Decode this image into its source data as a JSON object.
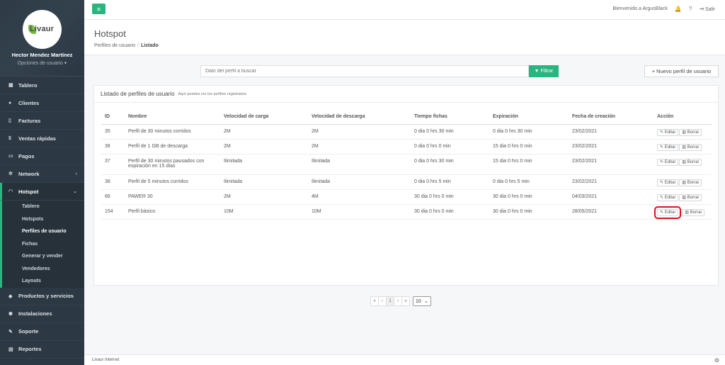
{
  "app": {
    "logo_text": "Livaur",
    "user_name": "Hector Mendez Martínez",
    "user_options": "Opciones de usuario ▾",
    "welcome": "Bienvenido a ArgusBlack",
    "logout": "Salir"
  },
  "sidebar": {
    "items": [
      {
        "label": "Tablero"
      },
      {
        "label": "Clientes"
      },
      {
        "label": "Facturas"
      },
      {
        "label": "Ventas rápidas"
      },
      {
        "label": "Pagos"
      },
      {
        "label": "Network"
      },
      {
        "label": "Hotspot"
      },
      {
        "label": "Productos y servicios"
      },
      {
        "label": "Instalaciones"
      },
      {
        "label": "Soporte"
      },
      {
        "label": "Reportes"
      }
    ],
    "hotspot_sub": [
      {
        "label": "Tablero"
      },
      {
        "label": "Hotspots"
      },
      {
        "label": "Perfiles de usuario"
      },
      {
        "label": "Fichas"
      },
      {
        "label": "Generar y vender"
      },
      {
        "label": "Vendedores"
      },
      {
        "label": "Layouts"
      }
    ]
  },
  "header": {
    "title": "Hotspot",
    "breadcrumb_parent": "Perfiles de usuario",
    "breadcrumb_current": "Listado"
  },
  "search": {
    "placeholder": "Dato del perfil a buscar",
    "filter_label": "Filtrar",
    "new_profile_label": "Nuevo perfil de usuario"
  },
  "panel": {
    "title": "Listado de perfiles de usuario",
    "subtitle": "Aquí puedes ver los perfiles registrados"
  },
  "table": {
    "headers": [
      "ID",
      "Nombre",
      "Velocidad de carga",
      "Velocidad de descarga",
      "Tiempo fichas",
      "Expiración",
      "Fecha de creación",
      "Acción"
    ],
    "rows": [
      [
        "35",
        "Perfil de 30 minutos corridos",
        "2M",
        "2M",
        "0 dia 0 hrs 30 min",
        "0 dia 0 hrs 30 min",
        "23/02/2021"
      ],
      [
        "36",
        "Perfil de 1 GB de descarga",
        "2M",
        "2M",
        "0 dia 0 hrs 0 min",
        "15 dia 0 hrs 0 min",
        "23/02/2021"
      ],
      [
        "37",
        "Perfil de 30 minutos pausados con expiración en 15 días",
        "Ilimitada",
        "Ilimitada",
        "0 dia 0 hrs 30 min",
        "15 dia 0 hrs 0 min",
        "23/02/2021"
      ],
      [
        "38",
        "Perfil de 5 minutos corridos",
        "Ilimitada",
        "Ilimitada",
        "0 dia 0 hrs 5 min",
        "0 dia 0 hrs 5 min",
        "23/02/2021"
      ],
      [
        "66",
        "PAWER 30",
        "2M",
        "4M",
        "30 dia 0 hrs 0 min",
        "30 dia 0 hrs 0 min",
        "04/03/2021"
      ],
      [
        "154",
        "Perfil básico",
        "10M",
        "10M",
        "30 dia 0 hrs 0 min",
        "30 dia 0 hrs 0 min",
        "28/05/2021"
      ]
    ],
    "edit_label": "Editar",
    "delete_label": "Borrar"
  },
  "pagination": {
    "first": "«",
    "prev": "‹",
    "page": "1",
    "next": "›",
    "last": "»",
    "per_page": "10"
  },
  "footer": {
    "text": "Livaur Internet"
  },
  "colors": {
    "accent": "#27b67f",
    "sidebar": "#2c3843",
    "highlight": "#d7141f"
  }
}
